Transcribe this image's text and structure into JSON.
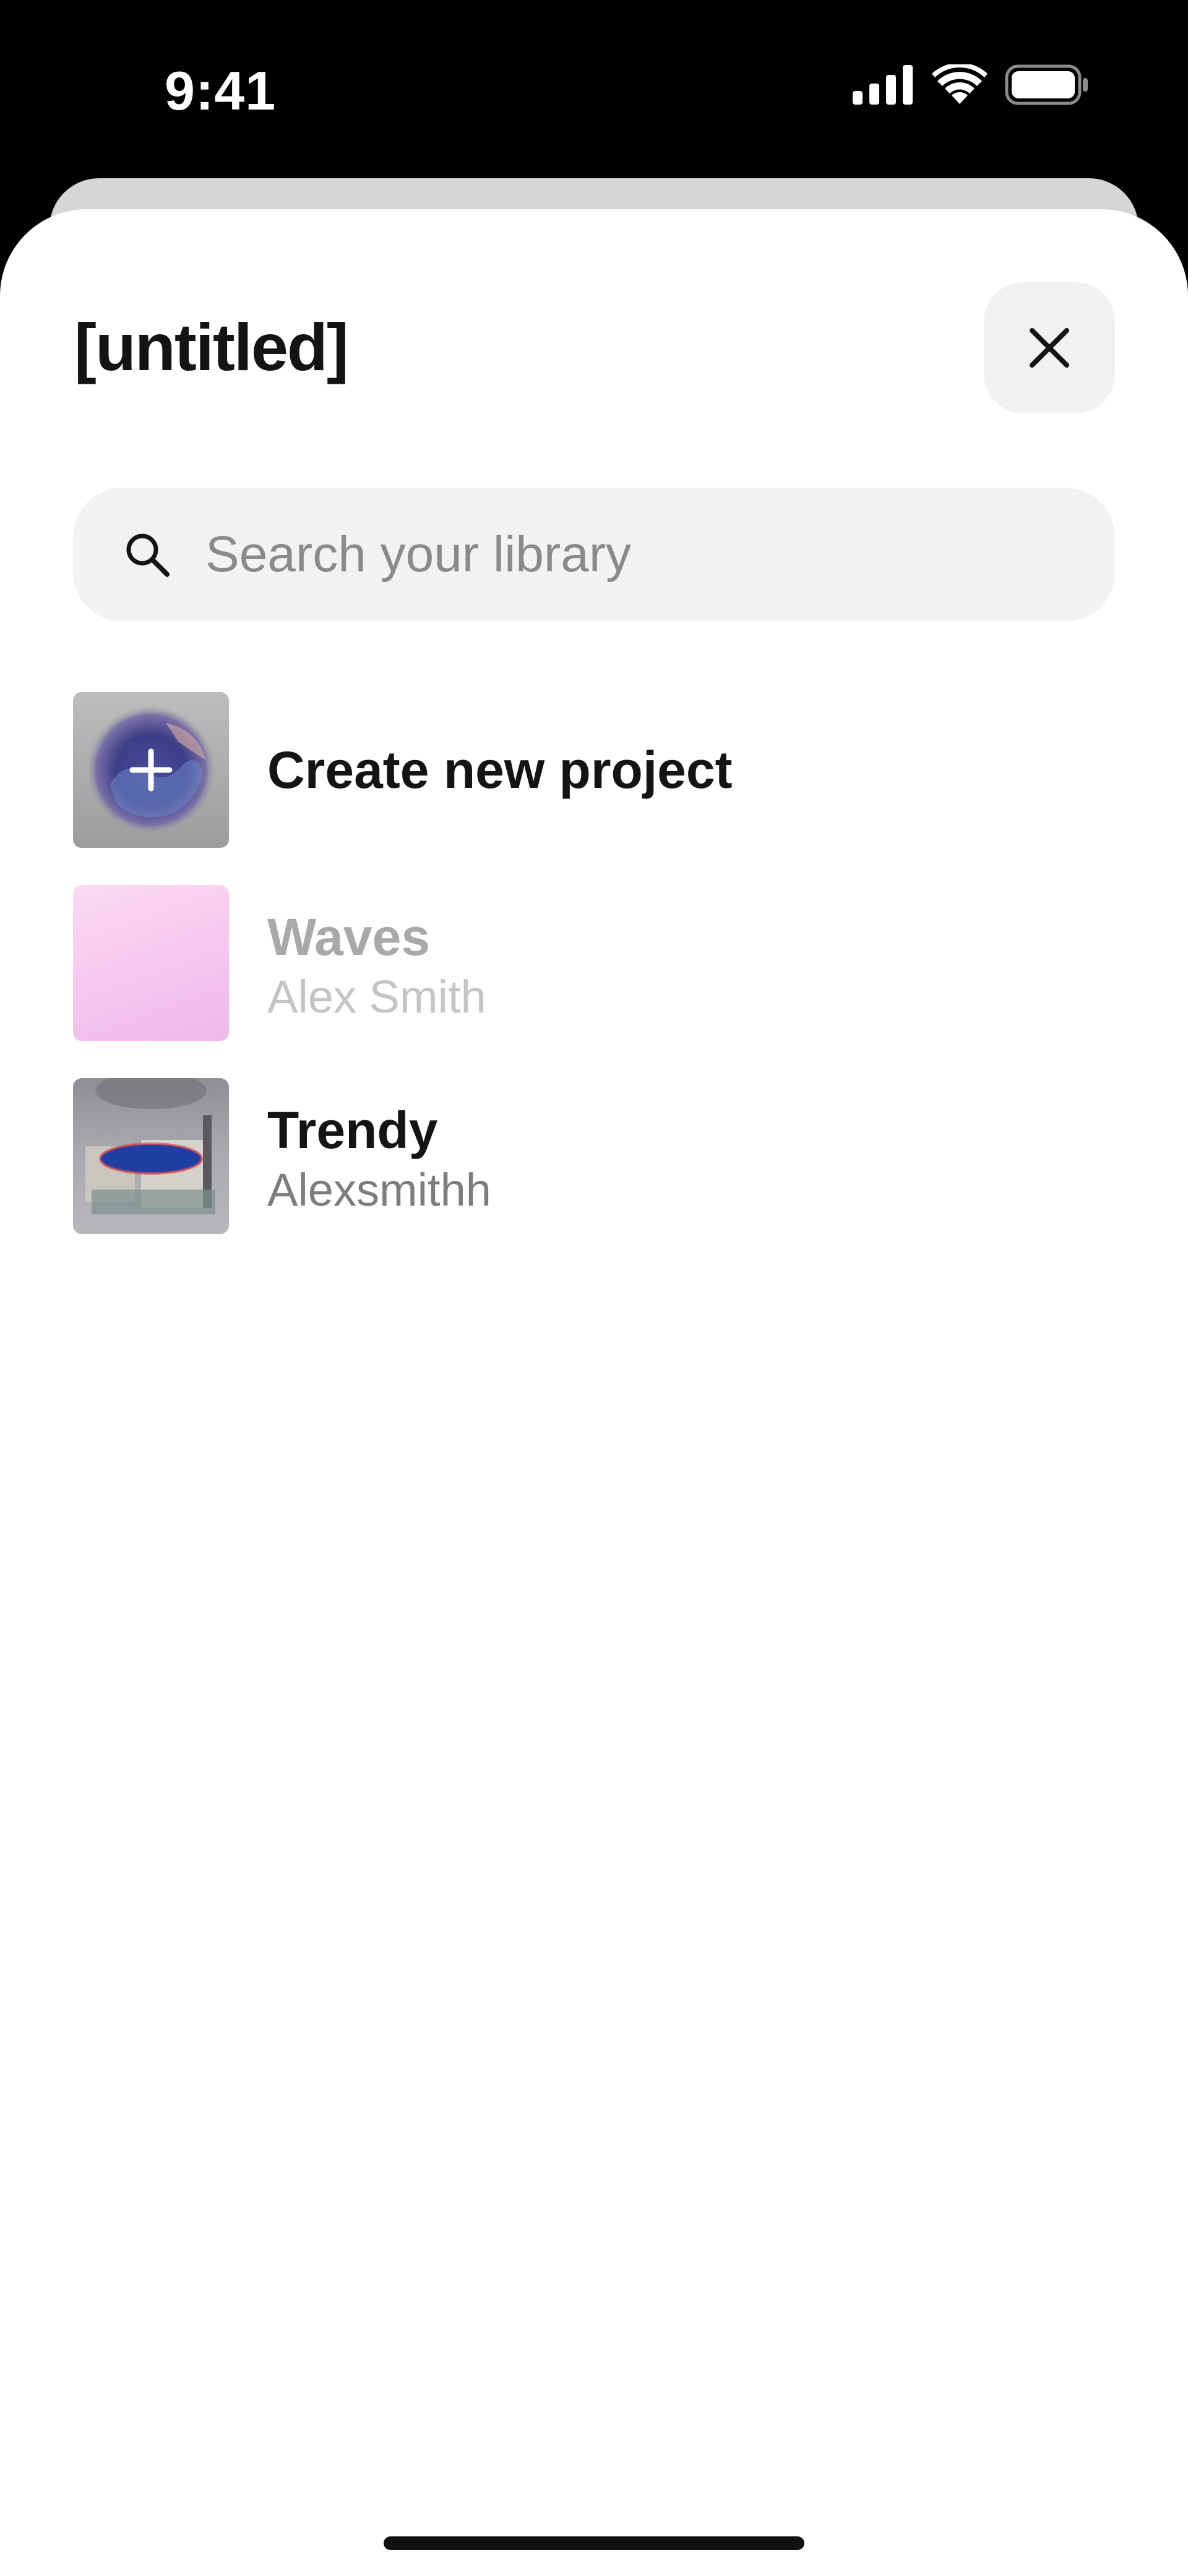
{
  "status_bar": {
    "time": "9:41",
    "icons": [
      "cellular-signal-icon",
      "wifi-icon",
      "battery-icon"
    ]
  },
  "sheet": {
    "title": "[untitled]",
    "close_icon": "close-icon"
  },
  "search": {
    "placeholder": "Search your library",
    "value": "",
    "icon": "search-icon"
  },
  "library": {
    "create_label": "Create new project",
    "items": [
      {
        "title": "Waves",
        "subtitle": "Alex Smith",
        "dimmed": true
      },
      {
        "title": "Trendy",
        "subtitle": "Alexsmithh",
        "dimmed": false
      }
    ]
  },
  "colors": {
    "background": "#000000",
    "sheet": "#ffffff",
    "search_bg": "#f2f2f2",
    "close_bg": "#f1f1f1",
    "text_primary": "#141414",
    "text_secondary": "#7d7d7d",
    "text_disabled": "#a9a9a9"
  }
}
